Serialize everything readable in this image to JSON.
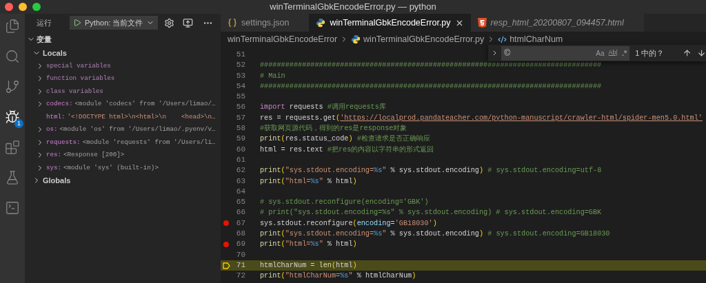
{
  "window": {
    "title": "winTerminalGbkEncodeError.py — python"
  },
  "activity_bar": [
    {
      "kind": "files",
      "selected": false
    },
    {
      "kind": "search",
      "selected": false
    },
    {
      "kind": "scm",
      "selected": false
    },
    {
      "kind": "debug",
      "selected": true,
      "badge": "1"
    },
    {
      "kind": "extensions",
      "selected": false
    },
    {
      "kind": "testing",
      "selected": false
    },
    {
      "kind": "terminal",
      "selected": false
    }
  ],
  "sidebar": {
    "title": "运行",
    "run_config": "Python: 当前文件",
    "section": {
      "title": "变量",
      "expanded": true,
      "scopes": [
        {
          "title": "Locals",
          "expanded": true,
          "items": [
            {
              "name": "special variables",
              "kind": "group",
              "expandable": true
            },
            {
              "name": "function variables",
              "kind": "group",
              "expandable": true
            },
            {
              "name": "class variables",
              "kind": "group",
              "expandable": true
            },
            {
              "name": "codecs:",
              "value": "<module 'codecs' from '/Users/limao/…",
              "kind": "object",
              "expandable": true
            },
            {
              "name": "html:",
              "value": "'<!DOCTYPE html>\\n<html>\\n    <head>\\n…",
              "kind": "string",
              "expandable": false
            },
            {
              "name": "os:",
              "value": "<module 'os' from '/Users/limao/.pyenv/v…",
              "kind": "object",
              "expandable": true
            },
            {
              "name": "requests:",
              "value": "<module 'requests' from '/Users/li…",
              "kind": "object",
              "expandable": true
            },
            {
              "name": "res:",
              "value": "<Response [200]>",
              "kind": "object",
              "expandable": true
            },
            {
              "name": "sys:",
              "value": "<module 'sys' (built-in)>",
              "kind": "object",
              "expandable": true
            }
          ]
        },
        {
          "title": "Globals",
          "expanded": false
        }
      ]
    }
  },
  "tabs": [
    {
      "label": "settings.json",
      "kind": "json",
      "selected": false,
      "preview": false
    },
    {
      "label": "winTerminalGbkEncodeError.py",
      "kind": "python",
      "selected": true,
      "preview": false
    },
    {
      "label": "resp_html_20200807_094457.html",
      "kind": "html",
      "selected": false,
      "preview": true
    }
  ],
  "breadcrumb": [
    {
      "label": "winTerminalGbkEncodeError",
      "kind": "folder"
    },
    {
      "label": "winTerminalGbkEncodeError.py",
      "kind": "python"
    },
    {
      "label": "htmlCharNum",
      "kind": "symbol"
    }
  ],
  "find_widget": {
    "value": "©",
    "toggles": [
      "Aa",
      "Ab|",
      ".*"
    ],
    "result": "1 中的？"
  },
  "code_lines": [
    {
      "number": "51",
      "breakpoint": false,
      "current": false
    },
    {
      "number": "52",
      "breakpoint": false,
      "current": false,
      "segments": [
        {
          "kind": "cmt",
          "text": "#################################################################################"
        }
      ]
    },
    {
      "number": "53",
      "breakpoint": false,
      "current": false,
      "segments": [
        {
          "kind": "cmt",
          "text": "# Main"
        }
      ]
    },
    {
      "number": "54",
      "breakpoint": false,
      "current": false,
      "segments": [
        {
          "kind": "cmt",
          "text": "#################################################################################"
        }
      ]
    },
    {
      "number": "55",
      "breakpoint": false,
      "current": false
    },
    {
      "number": "56",
      "breakpoint": false,
      "current": false,
      "segments": [
        {
          "kind": "kw",
          "text": "import"
        },
        {
          "kind": "plain",
          "text": " requests "
        },
        {
          "kind": "cmt",
          "text": "#调用requests库"
        }
      ]
    },
    {
      "number": "57",
      "breakpoint": false,
      "current": false,
      "segments": [
        {
          "kind": "plain",
          "text": "res = requests.get"
        },
        {
          "kind": "paren",
          "text": "("
        },
        {
          "kind": "url",
          "text": "'https://localprod.pandateacher.com/python-manuscript/crawler-html/spider-men5.0.html'"
        }
      ]
    },
    {
      "number": "58",
      "breakpoint": false,
      "current": false,
      "segments": [
        {
          "kind": "cmt",
          "text": "#获取网页源代码，得到的res是response对象"
        }
      ]
    },
    {
      "number": "59",
      "breakpoint": false,
      "current": false,
      "segments": [
        {
          "kind": "fn",
          "text": "print"
        },
        {
          "kind": "paren",
          "text": "("
        },
        {
          "kind": "plain",
          "text": "res.status_code"
        },
        {
          "kind": "paren",
          "text": ")"
        },
        {
          "kind": "cmt",
          "text": " #检查请求是否正确响应"
        }
      ]
    },
    {
      "number": "60",
      "breakpoint": false,
      "current": false,
      "segments": [
        {
          "kind": "plain",
          "text": "html = res.text "
        },
        {
          "kind": "cmt",
          "text": "#把res的内容以字符串的形式返回"
        }
      ]
    },
    {
      "number": "61",
      "breakpoint": false,
      "current": false
    },
    {
      "number": "62",
      "breakpoint": false,
      "current": false,
      "segments": [
        {
          "kind": "fn",
          "text": "print"
        },
        {
          "kind": "paren",
          "text": "("
        },
        {
          "kind": "str",
          "text": "\"sys.stdout.encoding="
        },
        {
          "kind": "fmt",
          "text": "%s"
        },
        {
          "kind": "str",
          "text": "\""
        },
        {
          "kind": "plain",
          "text": " % sys.stdout.encoding"
        },
        {
          "kind": "paren",
          "text": ")"
        },
        {
          "kind": "cmt",
          "text": " # sys.stdout.encoding=utf-8"
        }
      ]
    },
    {
      "number": "63",
      "breakpoint": false,
      "current": false,
      "segments": [
        {
          "kind": "fn",
          "text": "print"
        },
        {
          "kind": "paren",
          "text": "("
        },
        {
          "kind": "str",
          "text": "\"html="
        },
        {
          "kind": "fmt",
          "text": "%s"
        },
        {
          "kind": "str",
          "text": "\""
        },
        {
          "kind": "plain",
          "text": " % html"
        },
        {
          "kind": "paren",
          "text": ")"
        }
      ]
    },
    {
      "number": "64",
      "breakpoint": false,
      "current": false
    },
    {
      "number": "65",
      "breakpoint": false,
      "current": false,
      "segments": [
        {
          "kind": "cmt",
          "text": "# sys.stdout.reconfigure(encoding='GBK')"
        }
      ]
    },
    {
      "number": "66",
      "breakpoint": false,
      "current": false,
      "segments": [
        {
          "kind": "cmt",
          "text": "# print(\"sys.stdout.encoding=%s\" % sys.stdout.encoding) # sys.stdout.encoding=GBK"
        }
      ]
    },
    {
      "number": "67",
      "breakpoint": true,
      "current": false,
      "segments": [
        {
          "kind": "plain",
          "text": "sys.stdout.reconfigure"
        },
        {
          "kind": "paren",
          "text": "("
        },
        {
          "kind": "param",
          "text": "encoding"
        },
        {
          "kind": "plain",
          "text": "="
        },
        {
          "kind": "str",
          "text": "'GB18030'"
        },
        {
          "kind": "paren",
          "text": ")"
        }
      ]
    },
    {
      "number": "68",
      "breakpoint": false,
      "current": false,
      "segments": [
        {
          "kind": "fn",
          "text": "print"
        },
        {
          "kind": "paren",
          "text": "("
        },
        {
          "kind": "str",
          "text": "\"sys.stdout.encoding="
        },
        {
          "kind": "fmt",
          "text": "%s"
        },
        {
          "kind": "str",
          "text": "\""
        },
        {
          "kind": "plain",
          "text": " % sys.stdout.encoding"
        },
        {
          "kind": "paren",
          "text": ")"
        },
        {
          "kind": "cmt",
          "text": " # sys.stdout.encoding=GB18030"
        }
      ]
    },
    {
      "number": "69",
      "breakpoint": true,
      "current": false,
      "segments": [
        {
          "kind": "fn",
          "text": "print"
        },
        {
          "kind": "paren",
          "text": "("
        },
        {
          "kind": "str",
          "text": "\"html="
        },
        {
          "kind": "fmt",
          "text": "%s"
        },
        {
          "kind": "str",
          "text": "\""
        },
        {
          "kind": "plain",
          "text": " % html"
        },
        {
          "kind": "paren",
          "text": ")"
        }
      ]
    },
    {
      "number": "70",
      "breakpoint": false,
      "current": false
    },
    {
      "number": "71",
      "breakpoint": false,
      "current": true,
      "segments": [
        {
          "kind": "plain",
          "text": "htmlCharNum = "
        },
        {
          "kind": "fn",
          "text": "len"
        },
        {
          "kind": "paren",
          "text": "("
        },
        {
          "kind": "plain",
          "text": "html"
        },
        {
          "kind": "paren",
          "text": ")"
        }
      ]
    },
    {
      "number": "72",
      "breakpoint": false,
      "current": false,
      "segments": [
        {
          "kind": "fn",
          "text": "print"
        },
        {
          "kind": "paren",
          "text": "("
        },
        {
          "kind": "str",
          "text": "\"htmlCharNum="
        },
        {
          "kind": "fmt",
          "text": "%s"
        },
        {
          "kind": "str",
          "text": "\""
        },
        {
          "kind": "plain",
          "text": " % htmlCharNum"
        },
        {
          "kind": "paren",
          "text": ")"
        }
      ]
    }
  ]
}
